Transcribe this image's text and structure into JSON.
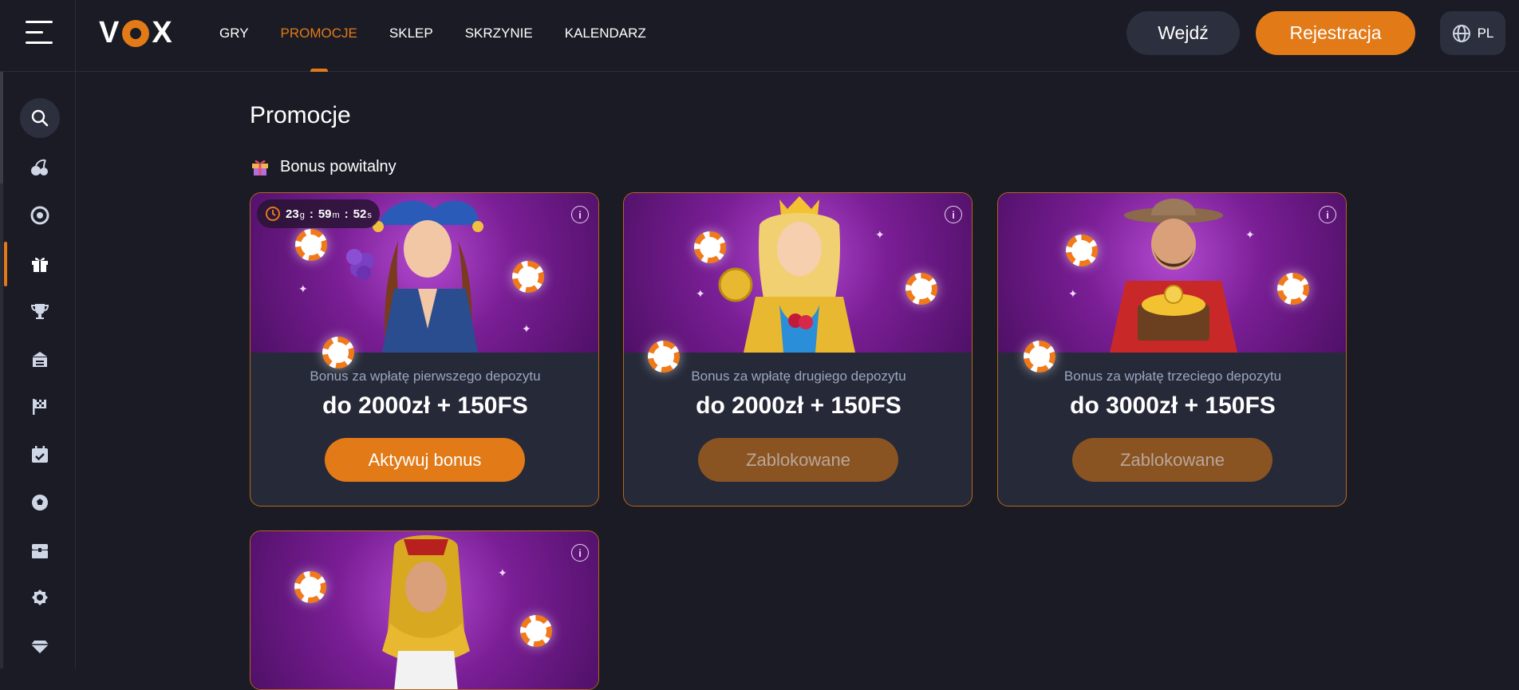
{
  "header": {
    "logo": "VOX",
    "nav": [
      {
        "label": "GRY",
        "active": false
      },
      {
        "label": "PROMOCJE",
        "active": true
      },
      {
        "label": "SKLEP",
        "active": false
      },
      {
        "label": "SKRZYNIE",
        "active": false
      },
      {
        "label": "KALENDARZ",
        "active": false
      }
    ],
    "login_label": "Wejdź",
    "register_label": "Rejestracja",
    "language": "PL"
  },
  "sidebar": {
    "icons": [
      "search-icon",
      "cherry-slots-icon",
      "live-casino-chip-icon",
      "gift-icon",
      "trophy-icon",
      "shop-icon",
      "tournament-flag-icon",
      "calendar-icon",
      "sports-ball-icon",
      "chest-icon",
      "achievement-badge-icon",
      "vip-diamond-icon"
    ],
    "active": "gift-icon"
  },
  "page": {
    "title": "Promocje",
    "section_title": "Bonus powitalny"
  },
  "cards": [
    {
      "subtitle": "Bonus za wpłatę pierwszego depozytu",
      "amount": "do 2000zł + 150FS",
      "button": "Aktywuj bonus",
      "enabled": true,
      "timer": {
        "days": "23",
        "days_unit": "g",
        "minutes": "59",
        "minutes_unit": "m",
        "seconds": "52",
        "seconds_unit": "s"
      }
    },
    {
      "subtitle": "Bonus za wpłatę drugiego depozytu",
      "amount": "do 2000zł + 150FS",
      "button": "Zablokowane",
      "enabled": false
    },
    {
      "subtitle": "Bonus za wpłatę trzeciego depozytu",
      "amount": "do 3000zł + 150FS",
      "button": "Zablokowane",
      "enabled": false
    },
    {
      "subtitle": "",
      "amount": "",
      "button": "",
      "enabled": false
    }
  ],
  "colors": {
    "accent": "#e27a18",
    "background": "#1a1b25",
    "card": "#262938",
    "muted_text": "#9aa7bd"
  }
}
